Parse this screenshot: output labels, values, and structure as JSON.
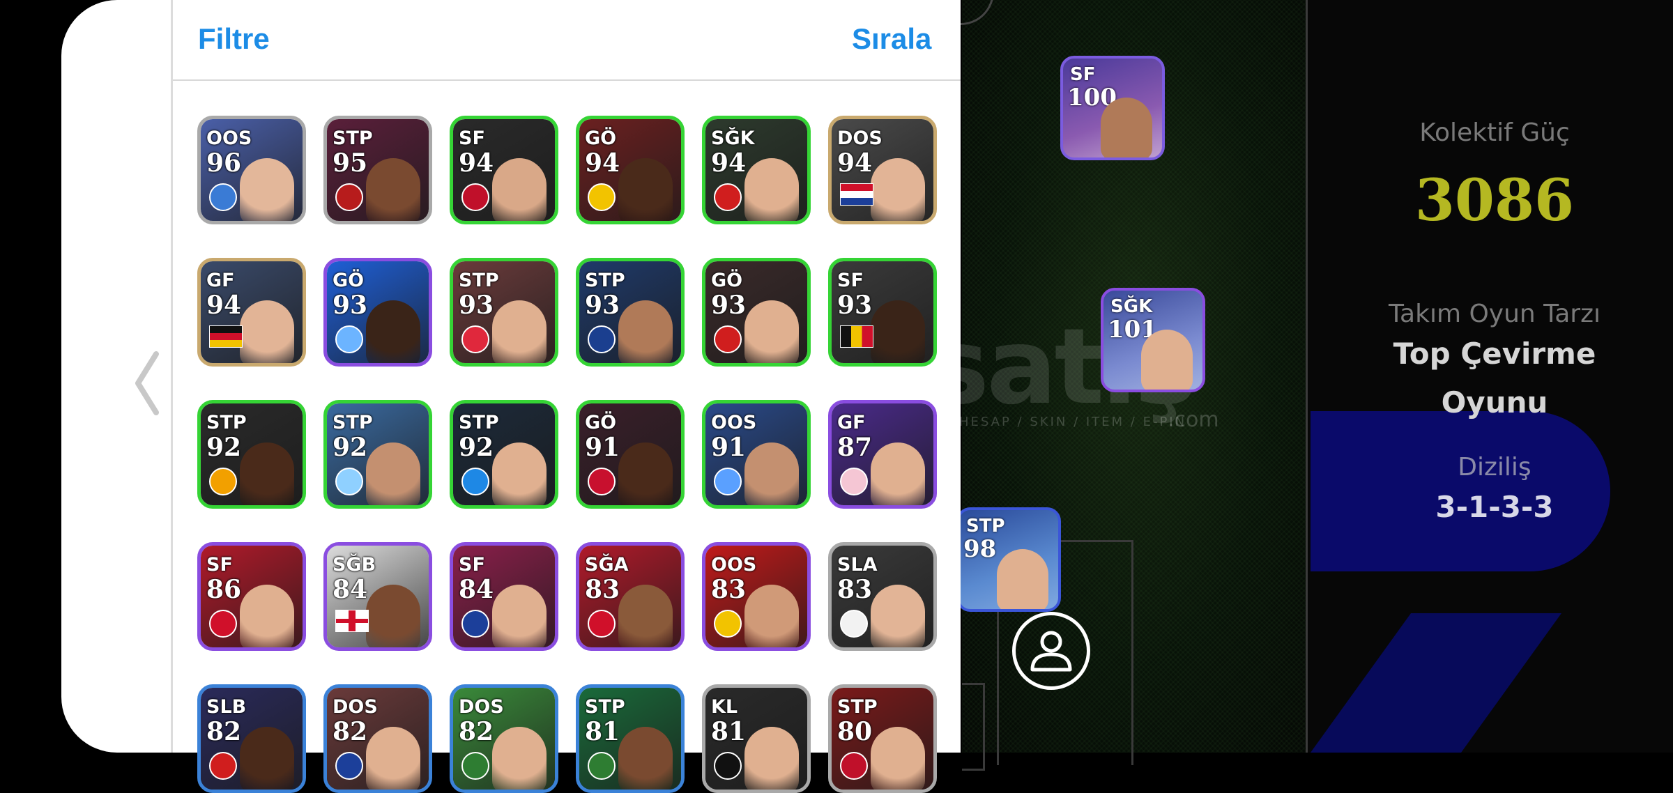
{
  "header": {
    "filter_label": "Filtre",
    "sort_label": "Sırala"
  },
  "team": {
    "collective_label": "Kolektif Güç",
    "collective_value": "3086",
    "style_label": "Takım Oyun Tarzı",
    "style_value_line1": "Top Çevirme",
    "style_value_line2": "Oyunu",
    "formation_label": "Diziliş",
    "formation_value": "3-1-3-3"
  },
  "watermark": {
    "main": "satış",
    "sub": "HESAP / SKIN / ITEM / E-PIN",
    "domain": ".com"
  },
  "pitch_players": [
    {
      "pos": "SF",
      "rating": "100"
    },
    {
      "pos": "SĞK",
      "rating": "101"
    },
    {
      "pos": "STP",
      "rating": "98"
    }
  ],
  "players": [
    {
      "pos": "OOS",
      "rating": "96",
      "border": "#a9a9a9",
      "bg": "#4a5fa8",
      "skin": "#e3b79a",
      "mark": "badge",
      "mark_color": "#3a7bd5"
    },
    {
      "pos": "STP",
      "rating": "95",
      "border": "#a9a9a9",
      "bg": "#5a1f3a",
      "skin": "#7a4a30",
      "mark": "badge",
      "mark_color": "#b71c1c"
    },
    {
      "pos": "SF",
      "rating": "94",
      "border": "#35d435",
      "bg": "#2a2a2a",
      "skin": "#d9a888",
      "mark": "badge",
      "mark_color": "#c0102a"
    },
    {
      "pos": "GÖ",
      "rating": "94",
      "border": "#35d435",
      "bg": "#6b2020",
      "skin": "#4a2a1a",
      "mark": "badge",
      "mark_color": "#f2c300"
    },
    {
      "pos": "SĞK",
      "rating": "94",
      "border": "#35d435",
      "bg": "#2d3a2d",
      "skin": "#e0b090",
      "mark": "badge",
      "mark_color": "#d01e1e"
    },
    {
      "pos": "DOS",
      "rating": "94",
      "border": "#c9a96e",
      "bg": "#4a4a4a",
      "skin": "#e2b496",
      "mark": "flag",
      "mark_color": "croatia"
    },
    {
      "pos": "GF",
      "rating": "94",
      "border": "#c9a96e",
      "bg": "#3a4a6a",
      "skin": "#e2b496",
      "mark": "flag",
      "mark_color": "germany"
    },
    {
      "pos": "GÖ",
      "rating": "93",
      "border": "#8a4de0",
      "bg": "#1f5fd6",
      "skin": "#3a2418",
      "mark": "badge",
      "mark_color": "#6cb4ff"
    },
    {
      "pos": "STP",
      "rating": "93",
      "border": "#35d435",
      "bg": "#6a3b3b",
      "skin": "#e0b090",
      "mark": "badge",
      "mark_color": "#e0283c"
    },
    {
      "pos": "STP",
      "rating": "93",
      "border": "#35d435",
      "bg": "#1f3a6a",
      "skin": "#b07a58",
      "mark": "badge",
      "mark_color": "#1b3f8f"
    },
    {
      "pos": "GÖ",
      "rating": "93",
      "border": "#35d435",
      "bg": "#3a2a2a",
      "skin": "#e0b090",
      "mark": "badge",
      "mark_color": "#d01e1e"
    },
    {
      "pos": "SF",
      "rating": "93",
      "border": "#35d435",
      "bg": "#3a3a3a",
      "skin": "#3a2418",
      "mark": "flag",
      "mark_color": "belgium"
    },
    {
      "pos": "STP",
      "rating": "92",
      "border": "#35d435",
      "bg": "#2a2a2a",
      "skin": "#4a2a1a",
      "mark": "badge",
      "mark_color": "#f2a000"
    },
    {
      "pos": "STP",
      "rating": "92",
      "border": "#35d435",
      "bg": "#3a6aa0",
      "skin": "#c49070",
      "mark": "badge",
      "mark_color": "#8fd0ff"
    },
    {
      "pos": "STP",
      "rating": "92",
      "border": "#35d435",
      "bg": "#1c2a3a",
      "skin": "#e0b090",
      "mark": "badge",
      "mark_color": "#1e88e5"
    },
    {
      "pos": "GÖ",
      "rating": "91",
      "border": "#35d435",
      "bg": "#3a1f2a",
      "skin": "#4a2a1a",
      "mark": "badge",
      "mark_color": "#c8102e"
    },
    {
      "pos": "OOS",
      "rating": "91",
      "border": "#35d435",
      "bg": "#2a4a8a",
      "skin": "#c49070",
      "mark": "badge",
      "mark_color": "#5aa0ff"
    },
    {
      "pos": "GF",
      "rating": "87",
      "border": "#8a4de0",
      "bg": "#4a2a8a",
      "skin": "#e0b090",
      "mark": "badge",
      "mark_color": "#f5c6d4"
    },
    {
      "pos": "SF",
      "rating": "86",
      "border": "#8a4de0",
      "bg": "#b01a2a",
      "skin": "#e0b090",
      "mark": "badge",
      "mark_color": "#d0102a"
    },
    {
      "pos": "SĞB",
      "rating": "84",
      "border": "#8a4de0",
      "bg": "#dcdcdc",
      "skin": "#7a4a30",
      "mark": "flag",
      "mark_color": "england"
    },
    {
      "pos": "SF",
      "rating": "84",
      "border": "#8a4de0",
      "bg": "#8a1f4a",
      "skin": "#e0b090",
      "mark": "badge",
      "mark_color": "#1c3f9a"
    },
    {
      "pos": "SĞA",
      "rating": "83",
      "border": "#8a4de0",
      "bg": "#b01a2a",
      "skin": "#8a5a3a",
      "mark": "badge",
      "mark_color": "#d0102a"
    },
    {
      "pos": "OOS",
      "rating": "83",
      "border": "#8a4de0",
      "bg": "#c01a1a",
      "skin": "#d09a78",
      "mark": "badge",
      "mark_color": "#f2c300"
    },
    {
      "pos": "SLA",
      "rating": "83",
      "border": "#a9a9a9",
      "bg": "#3a3a3a",
      "skin": "#e2b496",
      "mark": "badge",
      "mark_color": "#f2f2f2"
    },
    {
      "pos": "SLB",
      "rating": "82",
      "border": "#3b82d8",
      "bg": "#2a2a5a",
      "skin": "#4a2a1a",
      "mark": "badge",
      "mark_color": "#d01e1e"
    },
    {
      "pos": "DOS",
      "rating": "82",
      "border": "#3b82d8",
      "bg": "#6a3a3a",
      "skin": "#e0b090",
      "mark": "badge",
      "mark_color": "#1c3f9a"
    },
    {
      "pos": "DOS",
      "rating": "82",
      "border": "#3b82d8",
      "bg": "#3a8a3a",
      "skin": "#e0b090",
      "mark": "badge",
      "mark_color": "#2e7d32"
    },
    {
      "pos": "STP",
      "rating": "81",
      "border": "#3b82d8",
      "bg": "#1a6a3a",
      "skin": "#7a4a30",
      "mark": "badge",
      "mark_color": "#2e7d32"
    },
    {
      "pos": "KL",
      "rating": "81",
      "border": "#a9a9a9",
      "bg": "#2a2a2a",
      "skin": "#e0b090",
      "mark": "badge",
      "mark_color": "#111111"
    },
    {
      "pos": "STP",
      "rating": "80",
      "border": "#a9a9a9",
      "bg": "#7a1a1a",
      "skin": "#e0b090",
      "mark": "badge",
      "mark_color": "#c0102a"
    }
  ]
}
